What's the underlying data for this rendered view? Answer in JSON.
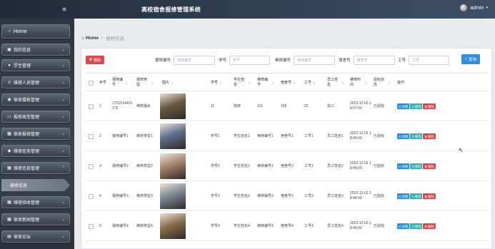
{
  "header": {
    "title": "高校宿舍报修管理系统",
    "user": "admin",
    "menu_icon": "menu-icon",
    "caret": "▾"
  },
  "sidebar": {
    "home": {
      "label": "Home",
      "icon": "home-icon"
    },
    "items": [
      {
        "label": "我的信息",
        "icon": "profile-icon"
      },
      {
        "label": "学生管理",
        "icon": "user-icon"
      },
      {
        "label": "维修人员管理",
        "icon": "list-icon"
      },
      {
        "label": "宿舍楼栋管理",
        "icon": "building-icon"
      },
      {
        "label": "报修类型管理",
        "icon": "monitor-icon"
      },
      {
        "label": "宿舍报修管理",
        "icon": "grid-icon"
      },
      {
        "label": "维修任务管理",
        "icon": "marker-icon"
      },
      {
        "label": "维修信息管理",
        "icon": "grid-icon"
      }
    ],
    "active_sub": "维修信息",
    "items_after": [
      {
        "label": "维修验收管理",
        "icon": "grid-icon"
      },
      {
        "label": "宿舍新闻管理",
        "icon": "grid-icon"
      },
      {
        "label": "宿舍论坛",
        "icon": "chat-icon"
      }
    ]
  },
  "breadcrumb": {
    "home": "Home",
    "current": "维修信息"
  },
  "toolbar": {
    "delete_label": "删除",
    "search_label": "查询",
    "filters": [
      {
        "label": "报修编号",
        "placeholder": "报修编号"
      },
      {
        "label": "学号",
        "placeholder": "学号"
      },
      {
        "label": "维修编号",
        "placeholder": "维修编号"
      },
      {
        "label": "宿舍号",
        "placeholder": "宿舍号"
      },
      {
        "label": "工号",
        "placeholder": "工号"
      }
    ]
  },
  "table": {
    "columns": [
      "序号",
      "报修编号",
      "报修类型",
      "图片",
      "学号",
      "学生姓名",
      "维修编号",
      "宿舍号",
      "工号",
      "员工姓名",
      "维修时间",
      "验收状态",
      "操作"
    ],
    "actions": {
      "view": "详情",
      "edit": "修改",
      "delete": "删除"
    },
    "rows": [
      {
        "no": "1",
        "repair_no": "1701514419279",
        "type": "维修漏水",
        "student_id": "11",
        "student_name": "陈晓",
        "maint_no": "101",
        "dorm": "106",
        "staff_id": "22",
        "staff_name": "张三",
        "time": "2023-12-02 18:57:50",
        "status": "已验收",
        "photo_color": "#6b5a42"
      },
      {
        "no": "2",
        "repair_no": "报修编号1",
        "type": "维修类型1",
        "student_id": "学号1",
        "student_name": "学生姓名1",
        "maint_no": "维修编号1",
        "dorm": "宿舍号1",
        "staff_id": "工号1",
        "staff_name": "员工姓名1",
        "time": "2023-12-02 18:48:00",
        "status": "已验收",
        "photo_color": "#5d6f8c"
      },
      {
        "no": "3",
        "repair_no": "报修编号2",
        "type": "维修类型2",
        "student_id": "学号2",
        "student_name": "学生姓名2",
        "maint_no": "维修编号2",
        "dorm": "宿舍号2",
        "staff_id": "工号2",
        "staff_name": "员工姓名2",
        "time": "2023-12-02 18:48:00",
        "status": "已验收",
        "photo_color": "#a7826a"
      },
      {
        "no": "4",
        "repair_no": "报修编号3",
        "type": "维修类型3",
        "student_id": "学号3",
        "student_name": "学生姓名3",
        "maint_no": "维修编号3",
        "dorm": "宿舍号3",
        "staff_id": "工号3",
        "staff_name": "员工姓名3",
        "time": "2023-12-02 18:48:00",
        "status": "已验收",
        "photo_color": "#7c8794"
      },
      {
        "no": "5",
        "repair_no": "报修编号4",
        "type": "维修类型4",
        "student_id": "学号4",
        "student_name": "学生姓名4",
        "maint_no": "维修编号4",
        "dorm": "宿舍号4",
        "staff_id": "工号4",
        "staff_name": "员工姓名4",
        "time": "2023-12-02 18:48:00",
        "status": "已验收",
        "photo_color": "#8a6e4c"
      }
    ]
  }
}
